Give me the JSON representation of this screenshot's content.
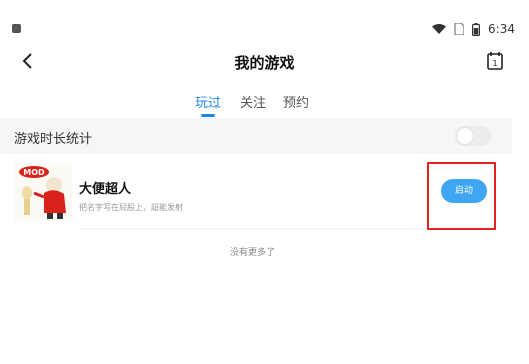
{
  "status_bar": {
    "time": "6:34"
  },
  "app_bar": {
    "title": "我的游戏"
  },
  "tabs": [
    {
      "label": "玩过",
      "active": true
    },
    {
      "label": "关注",
      "active": false
    },
    {
      "label": "预约",
      "active": false
    }
  ],
  "stats": {
    "label": "游戏时长统计",
    "toggle_on": false
  },
  "games": [
    {
      "name": "大便超人",
      "description": "把名字写在屁股上，超能发射",
      "launch_label": "启动",
      "thumbnail_badge": "MOD"
    }
  ],
  "footer": {
    "no_more": "没有更多了"
  },
  "colors": {
    "accent": "#1f88e5",
    "button": "#3ea6f2",
    "highlight": "#e0231c"
  }
}
